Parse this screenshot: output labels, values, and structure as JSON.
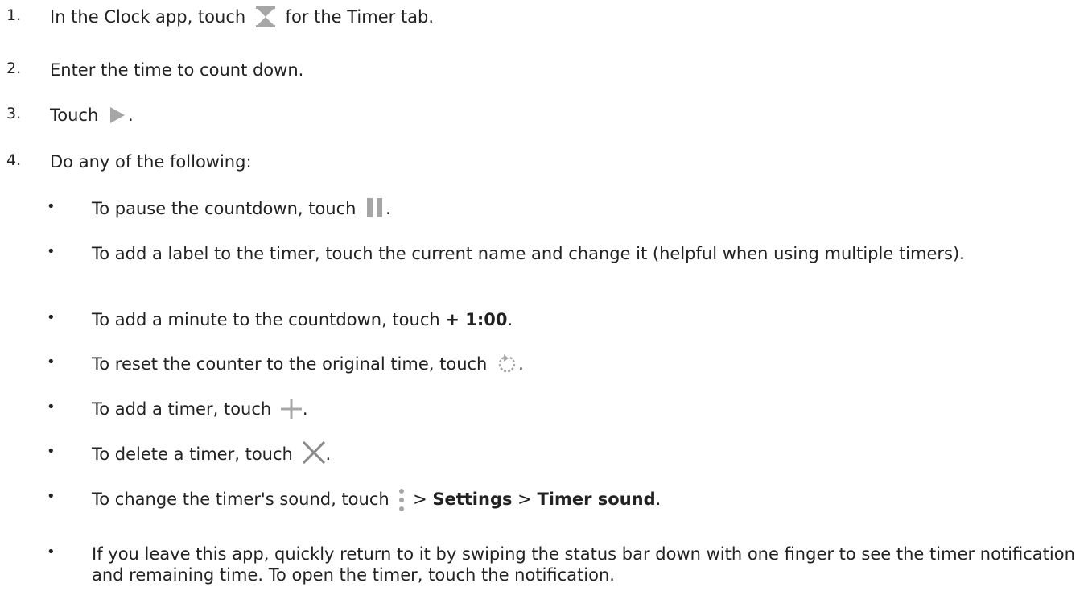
{
  "steps": [
    {
      "num": "1.",
      "before": "In the Clock app, touch",
      "icon": "hourglass-icon",
      "after": "for the Timer tab."
    },
    {
      "num": "2.",
      "text": "Enter the time to count down."
    },
    {
      "num": "3.",
      "before": "Touch",
      "icon": "play-icon",
      "after": "."
    },
    {
      "num": "4.",
      "text": "Do any of the following:"
    }
  ],
  "bullets": {
    "marker": "•",
    "pause": {
      "before": "To pause the countdown, touch",
      "icon": "pause-icon",
      "after": "."
    },
    "label": {
      "text": "To add a label to the timer, touch the current name and change it (helpful when using multiple timers)."
    },
    "minute": {
      "before": "To add a minute to the countdown, touch",
      "bold": "+ 1:00",
      "after": "."
    },
    "reset": {
      "before": "To reset the counter to the original time, touch",
      "icon": "reset-icon",
      "after": "."
    },
    "add": {
      "before": "To add a timer, touch",
      "icon": "plus-icon",
      "after": "."
    },
    "delete": {
      "before": "To delete a timer, touch",
      "icon": "close-icon",
      "after": "."
    },
    "sound": {
      "before": "To change the timer's sound, touch",
      "icon": "more-vertical-icon",
      "sep1": ">",
      "bold1": "Settings",
      "sep2": ">",
      "bold2": "Timer sound",
      "after": "."
    },
    "leave": {
      "text": "If you leave this app, quickly return to it by swiping the status bar down with one finger to see the timer notification and remaining time. To open the timer, touch the notification."
    }
  },
  "colors": {
    "text": "#222222",
    "icon": "#a6a6a6"
  }
}
